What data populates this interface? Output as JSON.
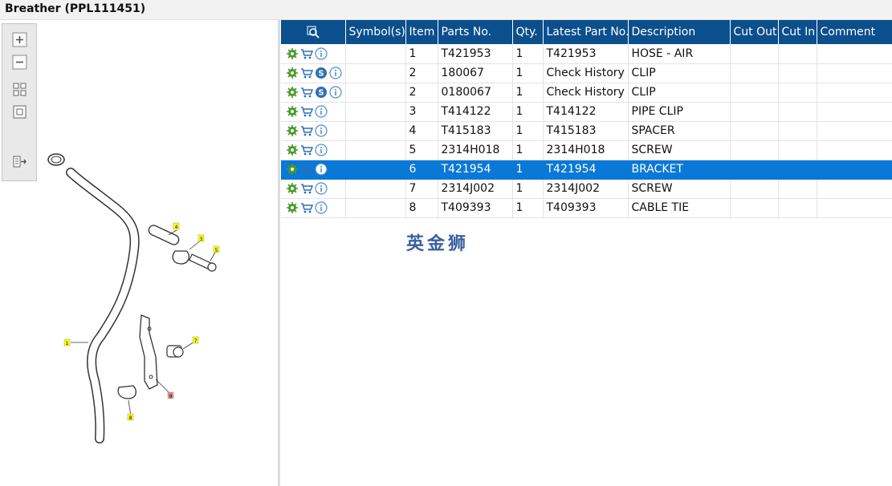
{
  "window": {
    "title": "Breather (PPL111451)"
  },
  "toolbar": {
    "tools": [
      {
        "name": "zoom-in-icon"
      },
      {
        "name": "zoom-out-icon"
      },
      {
        "name": "fit-all-icon"
      },
      {
        "name": "fit-window-icon"
      },
      {
        "name": "list-toggle-icon"
      }
    ]
  },
  "diagram": {
    "callouts": [
      "1",
      "3",
      "4",
      "5",
      "7",
      "8",
      "9"
    ],
    "highlight_color": "#ffff00",
    "selected_callout_color": "#e88"
  },
  "table": {
    "headers": [
      "",
      "Symbol(s)",
      "Item",
      "Parts No.",
      "Qty.",
      "Latest Part No.",
      "Description",
      "Cut Out",
      "Cut In",
      "Comment"
    ],
    "rows": [
      {
        "icons": [
          "settings-icon",
          "cart-icon",
          "info-icon"
        ],
        "symbols": "",
        "item": "1",
        "part": "T421953",
        "qty": "1",
        "latest": "T421953",
        "desc": "HOSE - AIR",
        "cut_out": "",
        "cut_in": "",
        "comment": "",
        "selected": false
      },
      {
        "icons": [
          "settings-icon",
          "cart-icon",
          "s-icon",
          "info-icon"
        ],
        "symbols": "",
        "item": "2",
        "part": "180067",
        "qty": "1",
        "latest": "Check History",
        "desc": "CLIP",
        "cut_out": "",
        "cut_in": "",
        "comment": "",
        "selected": false
      },
      {
        "icons": [
          "settings-icon",
          "cart-icon",
          "s-icon",
          "info-icon"
        ],
        "symbols": "",
        "item": "2",
        "part": "0180067",
        "qty": "1",
        "latest": "Check History",
        "desc": "CLIP",
        "cut_out": "",
        "cut_in": "",
        "comment": "",
        "selected": false
      },
      {
        "icons": [
          "settings-icon",
          "cart-icon",
          "info-icon"
        ],
        "symbols": "",
        "item": "3",
        "part": "T414122",
        "qty": "1",
        "latest": "T414122",
        "desc": "PIPE CLIP",
        "cut_out": "",
        "cut_in": "",
        "comment": "",
        "selected": false
      },
      {
        "icons": [
          "settings-icon",
          "cart-icon",
          "info-icon"
        ],
        "symbols": "",
        "item": "4",
        "part": "T415183",
        "qty": "1",
        "latest": "T415183",
        "desc": "SPACER",
        "cut_out": "",
        "cut_in": "",
        "comment": "",
        "selected": false
      },
      {
        "icons": [
          "settings-icon",
          "cart-icon",
          "info-icon"
        ],
        "symbols": "",
        "item": "5",
        "part": "2314H018",
        "qty": "1",
        "latest": "2314H018",
        "desc": "SCREW",
        "cut_out": "",
        "cut_in": "",
        "comment": "",
        "selected": false
      },
      {
        "icons": [
          "settings-icon",
          "cart-icon",
          "info-icon"
        ],
        "symbols": "",
        "item": "6",
        "part": "T421954",
        "qty": "1",
        "latest": "T421954",
        "desc": "BRACKET",
        "cut_out": "",
        "cut_in": "",
        "comment": "",
        "selected": true
      },
      {
        "icons": [
          "settings-icon",
          "cart-icon",
          "info-icon"
        ],
        "symbols": "",
        "item": "7",
        "part": "2314J002",
        "qty": "1",
        "latest": "2314J002",
        "desc": "SCREW",
        "cut_out": "",
        "cut_in": "",
        "comment": "",
        "selected": false
      },
      {
        "icons": [
          "settings-icon",
          "cart-icon",
          "info-icon"
        ],
        "symbols": "",
        "item": "8",
        "part": "T409393",
        "qty": "1",
        "latest": "T409393",
        "desc": "CABLE TIE",
        "cut_out": "",
        "cut_in": "",
        "comment": "",
        "selected": false
      }
    ]
  },
  "watermark": {
    "text": "英金狮"
  },
  "colors": {
    "header_bg": "#0b4f8c",
    "selected_row": "#0a78d7",
    "gear_green": "#4a9a2a",
    "cart_blue": "#2f6fb6",
    "info_blue": "#4a8fd0"
  }
}
